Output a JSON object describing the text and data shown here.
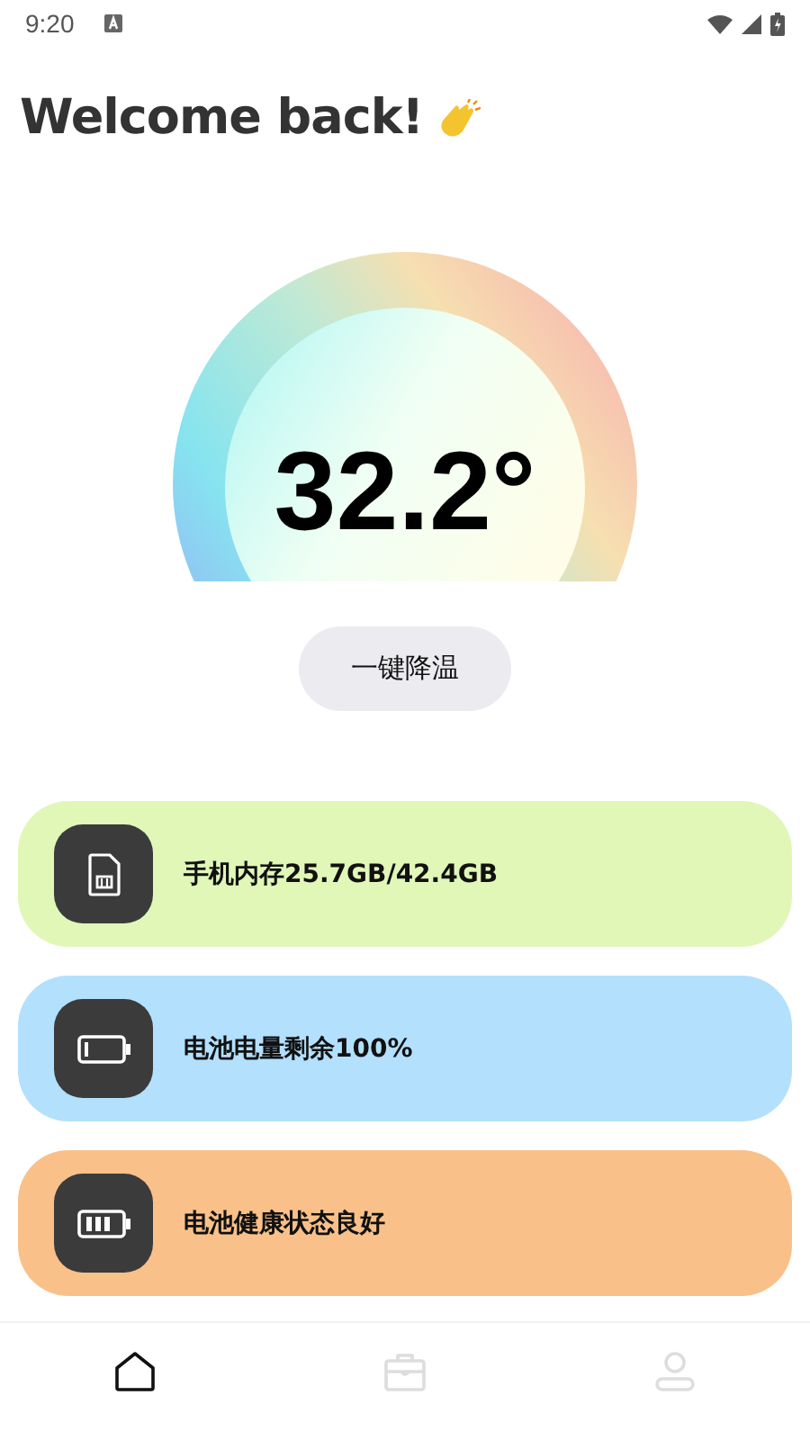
{
  "status_bar": {
    "time": "9:20"
  },
  "greeting": {
    "title": "Welcome back!"
  },
  "gauge": {
    "reading": "32.2°"
  },
  "cool_button": {
    "label": "一键降温"
  },
  "cards": [
    {
      "kind": "storage",
      "label": "手机内存25.7GB/42.4GB",
      "color": "#e1f7b8"
    },
    {
      "kind": "battery-level",
      "label": "电池电量剩余100%",
      "color": "#b3e0fd"
    },
    {
      "kind": "battery-health",
      "label": "电池健康状态良好",
      "color": "#f9c189"
    }
  ],
  "nav": [
    {
      "kind": "home",
      "selected": true
    },
    {
      "kind": "toolbox",
      "selected": false
    },
    {
      "kind": "profile",
      "selected": false
    }
  ]
}
